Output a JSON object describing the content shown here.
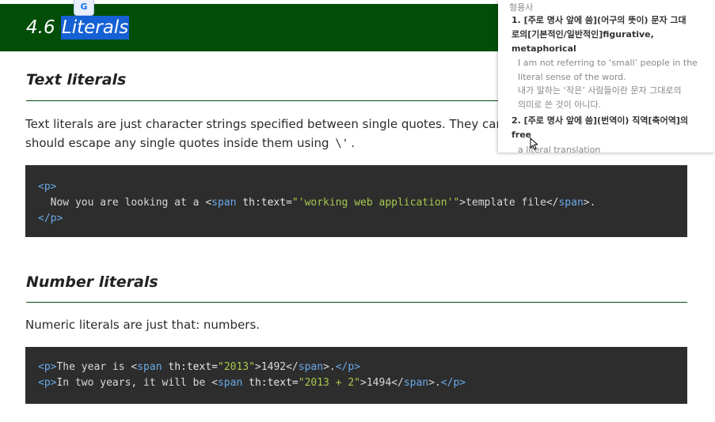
{
  "header": {
    "number": "4.6",
    "title_selected": "Literals",
    "background_color": "#024e07",
    "selection_color": "#1560d4"
  },
  "translate_badge": {
    "icon": "google-translate-icon"
  },
  "sections": [
    {
      "heading": "Text literals",
      "paragraph_lines": [
        "Text literals are just character strings specified between single quotes. They can inc",
        "should escape any single quotes inside them using"
      ],
      "inline_code": "\\'",
      "trailing": "."
    },
    {
      "heading": "Number literals",
      "paragraph_lines": [
        "Numeric literals are just that: numbers."
      ]
    }
  ],
  "code_text": {
    "l1_tag_open": "<p>",
    "l2_indent_text": "  Now you are looking at a ",
    "l2_span_lt": "<",
    "l2_span": "span",
    "l2_attr": " th:text=",
    "l2_value": "\"'working web application'\"",
    "l2_gt": ">template file</",
    "l2_span_close": "span",
    "l2_end": ">.",
    "l3_tag_close": "</p>"
  },
  "code_number": {
    "l1_p_open": "<p>",
    "l1_text": "The year is <",
    "l1_span": "span",
    "l1_attr": " th:text=",
    "l1_value": "\"2013\"",
    "l1_mid": ">1492</",
    "l1_span_close": "span",
    "l1_end": ">.",
    "l1_p_close": "</p>",
    "l2_p_open": "<p>",
    "l2_text": "In two years, it will be <",
    "l2_span": "span",
    "l2_attr": " th:text=",
    "l2_value": "\"2013 + 2\"",
    "l2_mid": ">1494</",
    "l2_span_close": "span",
    "l2_end": ">.",
    "l2_p_close": "</p>"
  },
  "dictionary": {
    "part_of_speech": "형용사",
    "def1_line1": "1. [주로 명사 앞에 씀](어구의 뜻이) 문자 그대",
    "def1_line2": "로의[기본적인/일반적인]figurative,",
    "def1_line3": "metaphorical",
    "ex1_line1": "I am not referring to ‘small’ people in the",
    "ex1_line2": "literal sense of the word.",
    "ex1_line3": "내가 말하는 ‘작은’ 사람들이란 문자 그대로의",
    "ex1_line4": "의미로 쓴 것이 아니다.",
    "def2_line1": "2. [주로 명사 앞에 씀](번역이) 직역[축어역]의",
    "def2_line2": "free",
    "ex2_line1": "a literal translation"
  },
  "colors": {
    "code_bg": "#2d2d2d",
    "code_tag": "#6aa9e8",
    "code_string": "#a7c84e"
  }
}
